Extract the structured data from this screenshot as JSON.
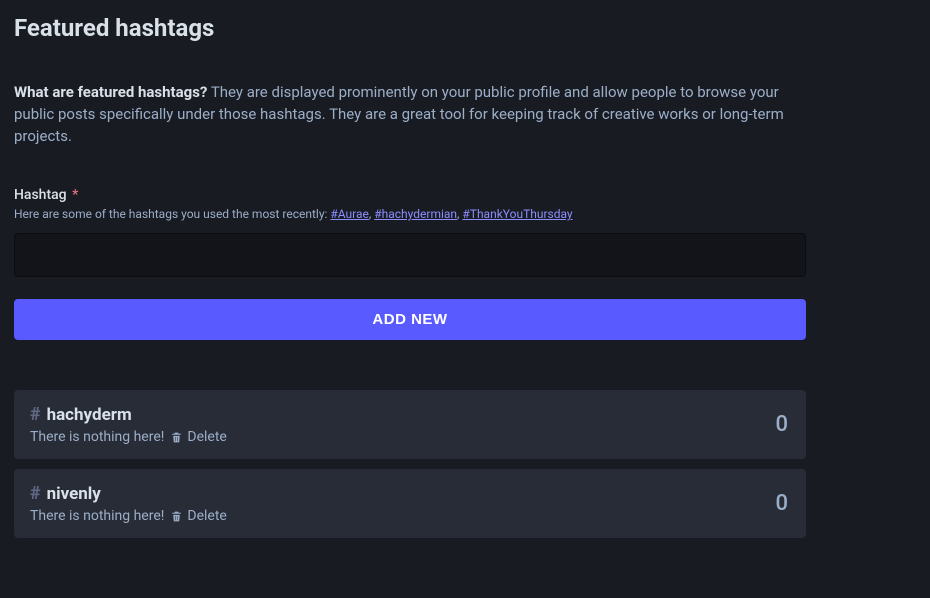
{
  "page": {
    "title": "Featured hashtags"
  },
  "intro": {
    "question": "What are featured hashtags?",
    "answer": "They are displayed prominently on your public profile and allow people to browse your public posts specifically under those hashtags. They are a great tool for keeping track of creative works or long-term projects."
  },
  "form": {
    "label": "Hashtag",
    "required_mark": "*",
    "hint_prefix": "Here are some of the hashtags you used the most recently: ",
    "suggestions": [
      {
        "text": "#Aurae"
      },
      {
        "text": "#hachydermian"
      },
      {
        "text": "#ThankYouThursday"
      }
    ],
    "input_value": "",
    "submit_label": "Add new"
  },
  "tags": [
    {
      "name": "hachyderm",
      "empty_text": "There is nothing here!",
      "delete_label": "Delete",
      "count": "0"
    },
    {
      "name": "nivenly",
      "empty_text": "There is nothing here!",
      "delete_label": "Delete",
      "count": "0"
    }
  ]
}
